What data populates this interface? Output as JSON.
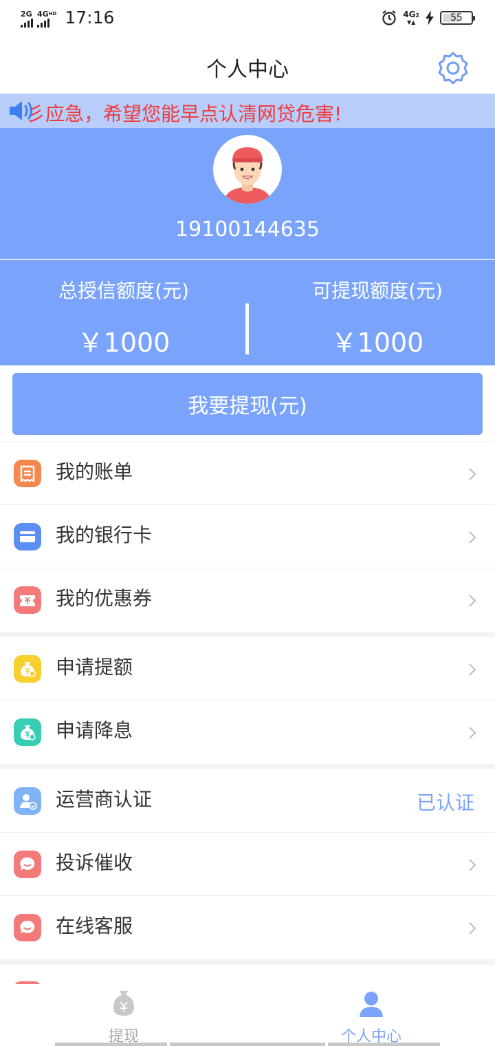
{
  "status_bar": {
    "signal_1": "2G",
    "signal_2": "4G",
    "signal_2_sup": "HD",
    "time": "17:16",
    "network": "4G",
    "network_sub": "2",
    "battery": "55"
  },
  "header": {
    "title": "个人中心",
    "settings_icon": "gear-icon"
  },
  "notice": {
    "text": "彡应急，希望您能早点认清网贷危害!",
    "icon": "speaker-icon"
  },
  "profile": {
    "phone": "19100144635",
    "credit_total_label": "总授信额度(元)",
    "credit_total_value": "￥1000",
    "credit_available_label": "可提现额度(元)",
    "credit_available_value": "￥1000"
  },
  "withdraw_button": "我要提现(元)",
  "menu_groups": [
    [
      {
        "label": "我的账单",
        "icon": "bill-icon",
        "color": "#f3894f"
      },
      {
        "label": "我的银行卡",
        "icon": "bank-card-icon",
        "color": "#5b8ff5"
      },
      {
        "label": "我的优惠券",
        "icon": "coupon-icon",
        "color": "#f47a7a"
      }
    ],
    [
      {
        "label": "申请提额",
        "icon": "money-bag-up-icon",
        "color": "#f7cf2f"
      },
      {
        "label": "申请降息",
        "icon": "money-bag-down-icon",
        "color": "#38cdb5"
      }
    ],
    [
      {
        "label": "运营商认证",
        "icon": "verified-user-icon",
        "color": "#7fb3f5",
        "status": "已认证"
      },
      {
        "label": "投诉催收",
        "icon": "chat-bubble-icon",
        "color": "#f47a7a"
      },
      {
        "label": "在线客服",
        "icon": "customer-service-icon",
        "color": "#f47a7a"
      }
    ]
  ],
  "tab_bar": {
    "tabs": [
      {
        "label": "提现",
        "icon": "money-bag-icon",
        "active": false
      },
      {
        "label": "个人中心",
        "icon": "person-icon",
        "active": true
      }
    ],
    "active_color": "#7aa4fb",
    "inactive_color": "#aaaaaa"
  }
}
